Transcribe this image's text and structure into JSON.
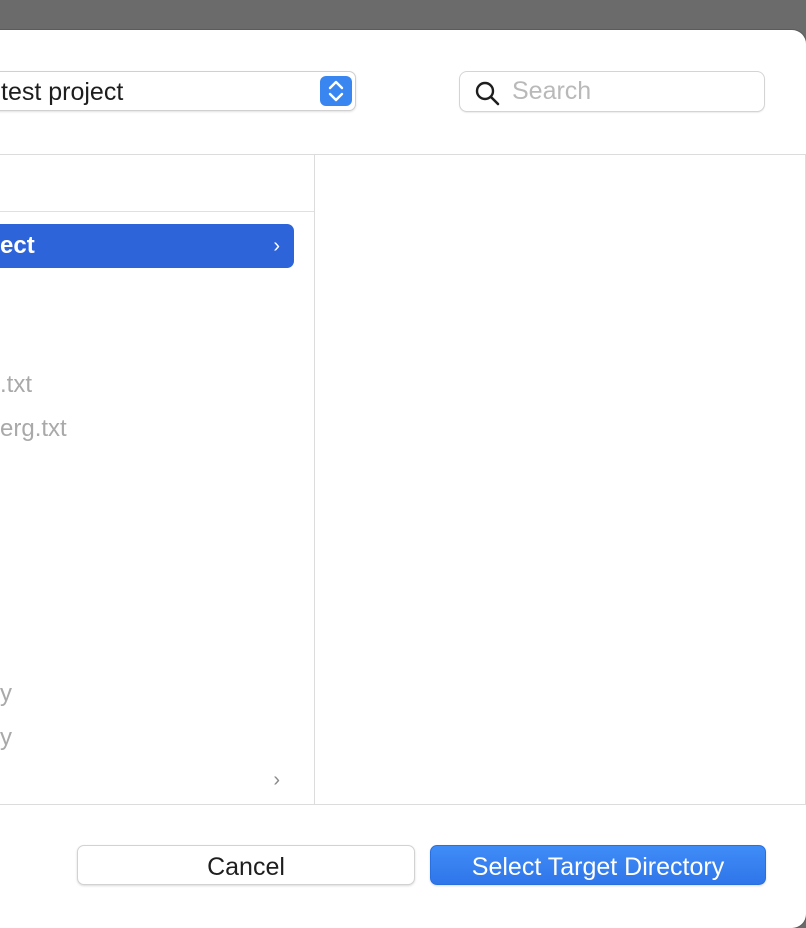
{
  "location": {
    "label": "test project"
  },
  "search": {
    "placeholder": "Search",
    "value": ""
  },
  "columns": {
    "left": {
      "items": [
        {
          "label": "ect",
          "state": "selected",
          "has_children": true
        },
        {
          "label": ".txt",
          "state": "dim",
          "has_children": false
        },
        {
          "label": "erg.txt",
          "state": "dim",
          "has_children": false
        },
        {
          "label": "y",
          "state": "dim",
          "has_children": false
        },
        {
          "label": "y",
          "state": "dim",
          "has_children": false
        },
        {
          "label": "",
          "state": "normal",
          "has_children": true
        }
      ]
    }
  },
  "footer": {
    "cancel_label": "Cancel",
    "confirm_label": "Select Target Directory"
  },
  "colors": {
    "accent": "#2d64da",
    "primary_button": "#3a86f0",
    "dim_text": "#a9a9a9"
  },
  "icons": {
    "search": "magnifying-glass-icon",
    "stepper": "up-down-chevron-icon",
    "disclosure": "chevron-right-icon"
  }
}
